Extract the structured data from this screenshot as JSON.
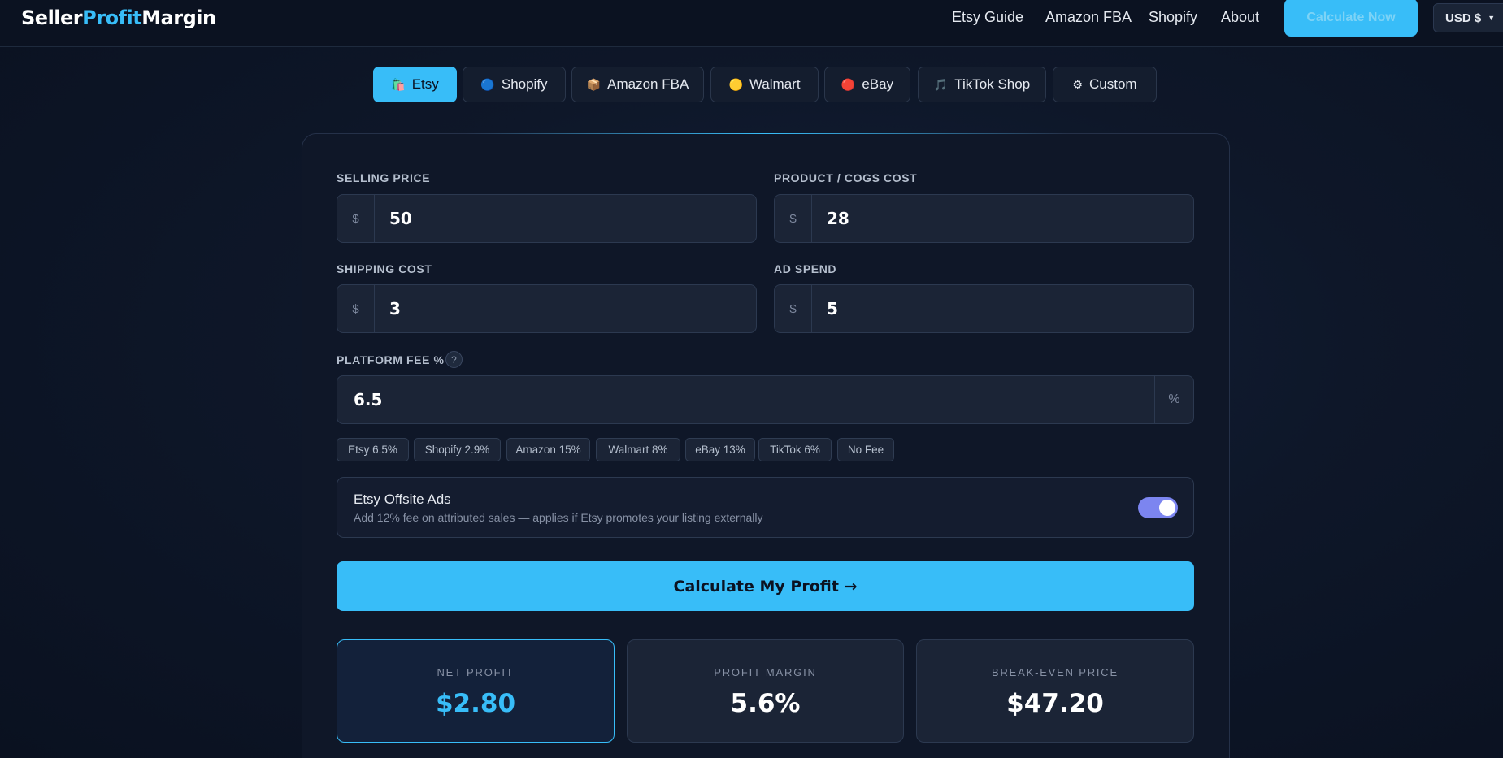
{
  "header": {
    "logo": {
      "part1": "Seller",
      "part2": "Profit",
      "part3": "Margin"
    },
    "nav": [
      "Etsy Guide",
      "Amazon FBA",
      "Shopify",
      "About"
    ],
    "cta_label": "Calculate Now",
    "currency_label": "USD $"
  },
  "tabs": [
    {
      "label": "Etsy",
      "icon": "🛍️",
      "active": true
    },
    {
      "label": "Shopify",
      "icon": "🔵"
    },
    {
      "label": "Amazon FBA",
      "icon": "📦"
    },
    {
      "label": "Walmart",
      "icon": "🟡"
    },
    {
      "label": "eBay",
      "icon": "🔴"
    },
    {
      "label": "TikTok Shop",
      "icon": "🎵"
    },
    {
      "label": "Custom",
      "icon": "⚙"
    }
  ],
  "form": {
    "selling_price": {
      "label": "SELLING PRICE",
      "prefix": "$",
      "value": "50"
    },
    "cogs": {
      "label": "PRODUCT / COGS COST",
      "prefix": "$",
      "value": "28"
    },
    "shipping": {
      "label": "SHIPPING COST",
      "prefix": "$",
      "value": "3"
    },
    "ad_spend": {
      "label": "AD SPEND",
      "prefix": "$",
      "value": "5"
    },
    "platform_fee": {
      "label": "PLATFORM FEE %",
      "help": "?",
      "value": "6.5",
      "suffix": "%"
    },
    "fee_presets": [
      "Etsy 6.5%",
      "Shopify 2.9%",
      "Amazon 15%",
      "Walmart 8%",
      "eBay 13%",
      "TikTok 6%",
      "No Fee"
    ],
    "offsite_ads": {
      "title": "Etsy Offsite Ads",
      "description": "Add 12% fee on attributed sales — applies if Etsy promotes your listing externally",
      "enabled": true
    },
    "calculate_label": "Calculate My Profit →"
  },
  "results": [
    {
      "label": "NET PROFIT",
      "value": "$2.80"
    },
    {
      "label": "PROFIT MARGIN",
      "value": "5.6%"
    },
    {
      "label": "BREAK-EVEN PRICE",
      "value": "$47.20"
    }
  ],
  "colors": {
    "accent": "#38bdf8",
    "toggle": "#7c85f0",
    "background": "#0e1729"
  }
}
